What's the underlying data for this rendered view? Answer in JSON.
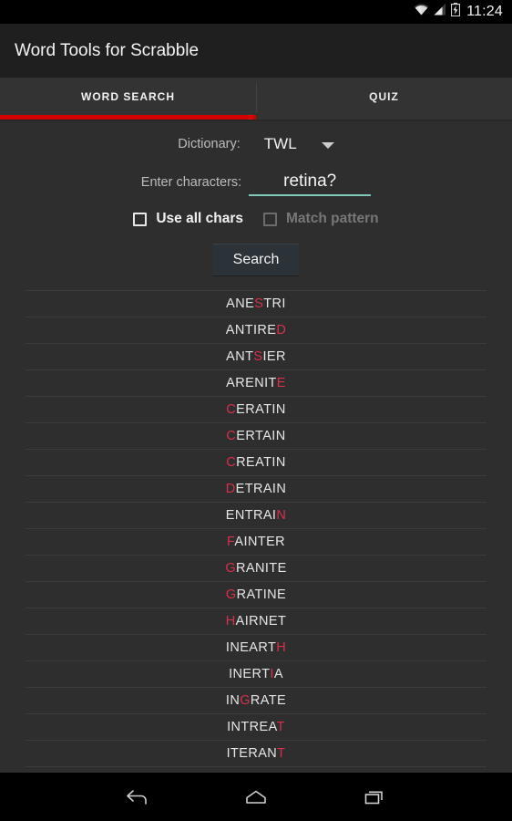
{
  "status_bar": {
    "time": "11:24",
    "icons": [
      "wifi-icon",
      "signal-icon",
      "battery-charging-icon"
    ]
  },
  "app_bar": {
    "title": "Word Tools for Scrabble"
  },
  "tabs": [
    {
      "label": "WORD SEARCH",
      "active": true
    },
    {
      "label": "QUIZ",
      "active": false
    }
  ],
  "colors": {
    "accent_red": "#d50000",
    "highlight_letter": "#d8304a",
    "field_underline": "#7fc9bc",
    "background": "#2e2e2e",
    "app_bar": "#1f1f1f",
    "tab_bar": "#333333"
  },
  "form": {
    "dictionary_label": "Dictionary:",
    "dictionary_value": "TWL",
    "dictionary_caret": "chevron-down-icon",
    "characters_label": "Enter characters:",
    "characters_value": "retina?",
    "characters_placeholder": "",
    "use_all_chars": {
      "label": "Use all chars",
      "checked": false,
      "enabled": true
    },
    "match_pattern": {
      "label": "Match pattern",
      "checked": false,
      "enabled": false
    },
    "search_button": "Search"
  },
  "results": [
    {
      "word": "ANESTRI",
      "highlight": [
        3
      ]
    },
    {
      "word": "ANTIRED",
      "highlight": [
        6
      ]
    },
    {
      "word": "ANTSIER",
      "highlight": [
        3
      ]
    },
    {
      "word": "ARENITE",
      "highlight": [
        6
      ]
    },
    {
      "word": "CERATIN",
      "highlight": [
        0
      ]
    },
    {
      "word": "CERTAIN",
      "highlight": [
        0
      ]
    },
    {
      "word": "CREATIN",
      "highlight": [
        0
      ]
    },
    {
      "word": "DETRAIN",
      "highlight": [
        0
      ]
    },
    {
      "word": "ENTRAIN",
      "highlight": [
        6
      ]
    },
    {
      "word": "FAINTER",
      "highlight": [
        0
      ]
    },
    {
      "word": "GRANITE",
      "highlight": [
        0
      ]
    },
    {
      "word": "GRATINE",
      "highlight": [
        0
      ]
    },
    {
      "word": "HAIRNET",
      "highlight": [
        0
      ]
    },
    {
      "word": "INEARTH",
      "highlight": [
        6
      ]
    },
    {
      "word": "INERTIA",
      "highlight": [
        5
      ]
    },
    {
      "word": "INGRATE",
      "highlight": [
        2
      ]
    },
    {
      "word": "INTREAT",
      "highlight": [
        6
      ]
    },
    {
      "word": "ITERANT",
      "highlight": [
        6
      ]
    }
  ],
  "nav_bar": {
    "back": "back-icon",
    "home": "home-icon",
    "recents": "recents-icon"
  }
}
